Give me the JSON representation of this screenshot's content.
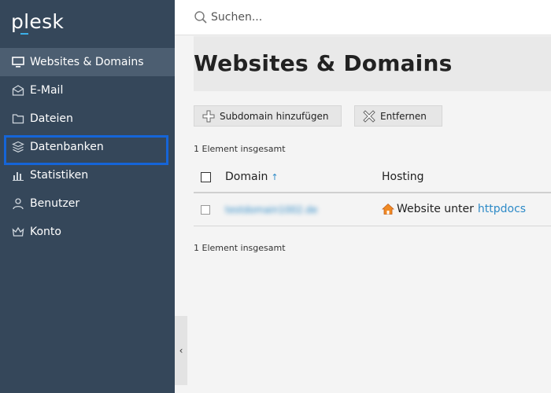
{
  "app": {
    "logo": "plesk"
  },
  "sidebar": {
    "items": [
      {
        "label": "Websites & Domains",
        "icon": "monitor-icon",
        "active": true
      },
      {
        "label": "E-Mail",
        "icon": "mail-icon"
      },
      {
        "label": "Dateien",
        "icon": "folder-icon"
      },
      {
        "label": "Datenbanken",
        "icon": "database-icon"
      },
      {
        "label": "Statistiken",
        "icon": "bar-chart-icon"
      },
      {
        "label": "Benutzer",
        "icon": "user-icon"
      },
      {
        "label": "Konto",
        "icon": "crown-icon"
      }
    ],
    "collapse_glyph": "‹"
  },
  "search": {
    "placeholder": "Suchen..."
  },
  "main": {
    "title": "Websites & Domains",
    "toolbar": {
      "add_subdomain_label": "Subdomain hinzufügen",
      "remove_label": "Entfernen"
    },
    "total_text": "1 Element insgesamt",
    "table": {
      "columns": {
        "domain": "Domain",
        "hosting": "Hosting"
      },
      "sort_glyph": "↑",
      "rows": [
        {
          "domain": "testdomain1002.de",
          "hosting_prefix": "Website unter",
          "hosting_link": "httpdocs"
        }
      ]
    }
  },
  "colors": {
    "sidebar_bg": "#35475a",
    "sidebar_active": "#4c5e71",
    "accent_link": "#2d8ac7",
    "highlight_box": "#1565d8"
  }
}
